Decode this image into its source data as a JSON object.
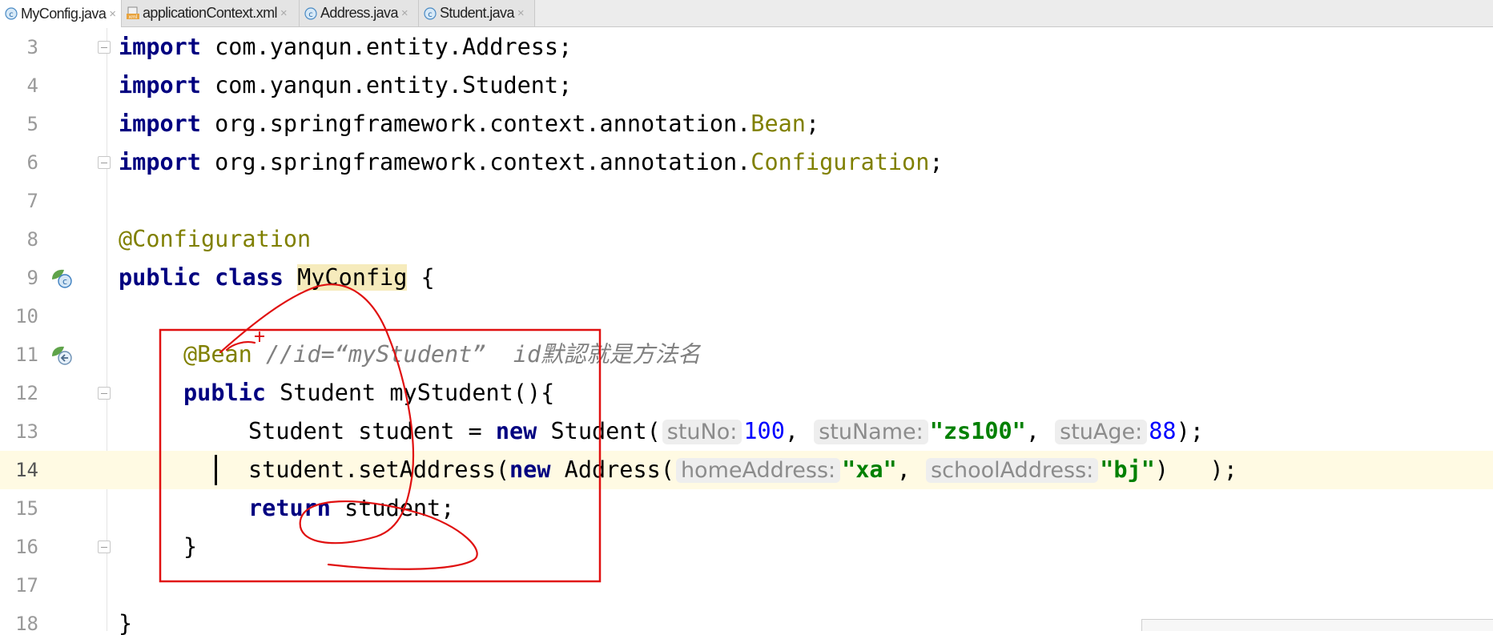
{
  "tabs": [
    {
      "label": "MyConfig.java",
      "icon": "java-class-icon",
      "active": true
    },
    {
      "label": "applicationContext.xml",
      "icon": "xml-file-icon",
      "active": false
    },
    {
      "label": "Address.java",
      "icon": "java-class-icon",
      "active": false
    },
    {
      "label": "Student.java",
      "icon": "java-class-icon",
      "active": false
    }
  ],
  "tab_close_glyph": "×",
  "line_numbers": [
    "3",
    "4",
    "5",
    "6",
    "7",
    "8",
    "9",
    "10",
    "11",
    "12",
    "13",
    "14",
    "15",
    "16",
    "17",
    "18"
  ],
  "current_line": "14",
  "code": {
    "l3": {
      "kw": "import",
      "pkg": " com.yanqun.entity.Address;"
    },
    "l4": {
      "kw": "import",
      "pkg": " com.yanqun.entity.Student;"
    },
    "l5": {
      "kw": "import",
      "pkg": " org.springframework.context.annotation.",
      "cls": "Bean",
      "end": ";"
    },
    "l6": {
      "kw": "import",
      "pkg": " org.springframework.context.annotation.",
      "cls": "Configuration",
      "end": ";"
    },
    "l8": {
      "ann": "@Configuration"
    },
    "l9": {
      "kw1": "public",
      "kw2": "class",
      "name": "MyConfig",
      "end": " {"
    },
    "l11": {
      "ann": "@Bean",
      "comment": " //id=“myStudent”  id默認就是方法名"
    },
    "l12": {
      "kw": "public",
      "rest": " Student myStudent(){"
    },
    "l13": {
      "pre": "Student student = ",
      "kw": "new",
      "mid": " Student(",
      "h1": "stuNo:",
      "v1": "100",
      "c1": ", ",
      "h2": "stuName:",
      "v2": "\"zs100\"",
      "c2": ", ",
      "h3": "stuAge:",
      "v3": "88",
      "end": ");"
    },
    "l14": {
      "pre": "student.setAddress(",
      "kw": "new",
      "mid": " Address(",
      "h1": "homeAddress:",
      "v1": "\"xa\"",
      "c1": ", ",
      "h2": "schoolAddress:",
      "v2": "\"bj\"",
      "end": ")   );"
    },
    "l15": {
      "kw": "return",
      "rest": " student;"
    },
    "l16": {
      "brace": "}"
    },
    "l18": {
      "brace": "}"
    }
  },
  "colors": {
    "keyword": "#000080",
    "annotation": "#808000",
    "string": "#008000",
    "number": "#0000ff",
    "comment": "#808080",
    "current_line": "#fffae3",
    "identifier_highlight": "#f6ebbc",
    "markup_red": "#e01010"
  }
}
